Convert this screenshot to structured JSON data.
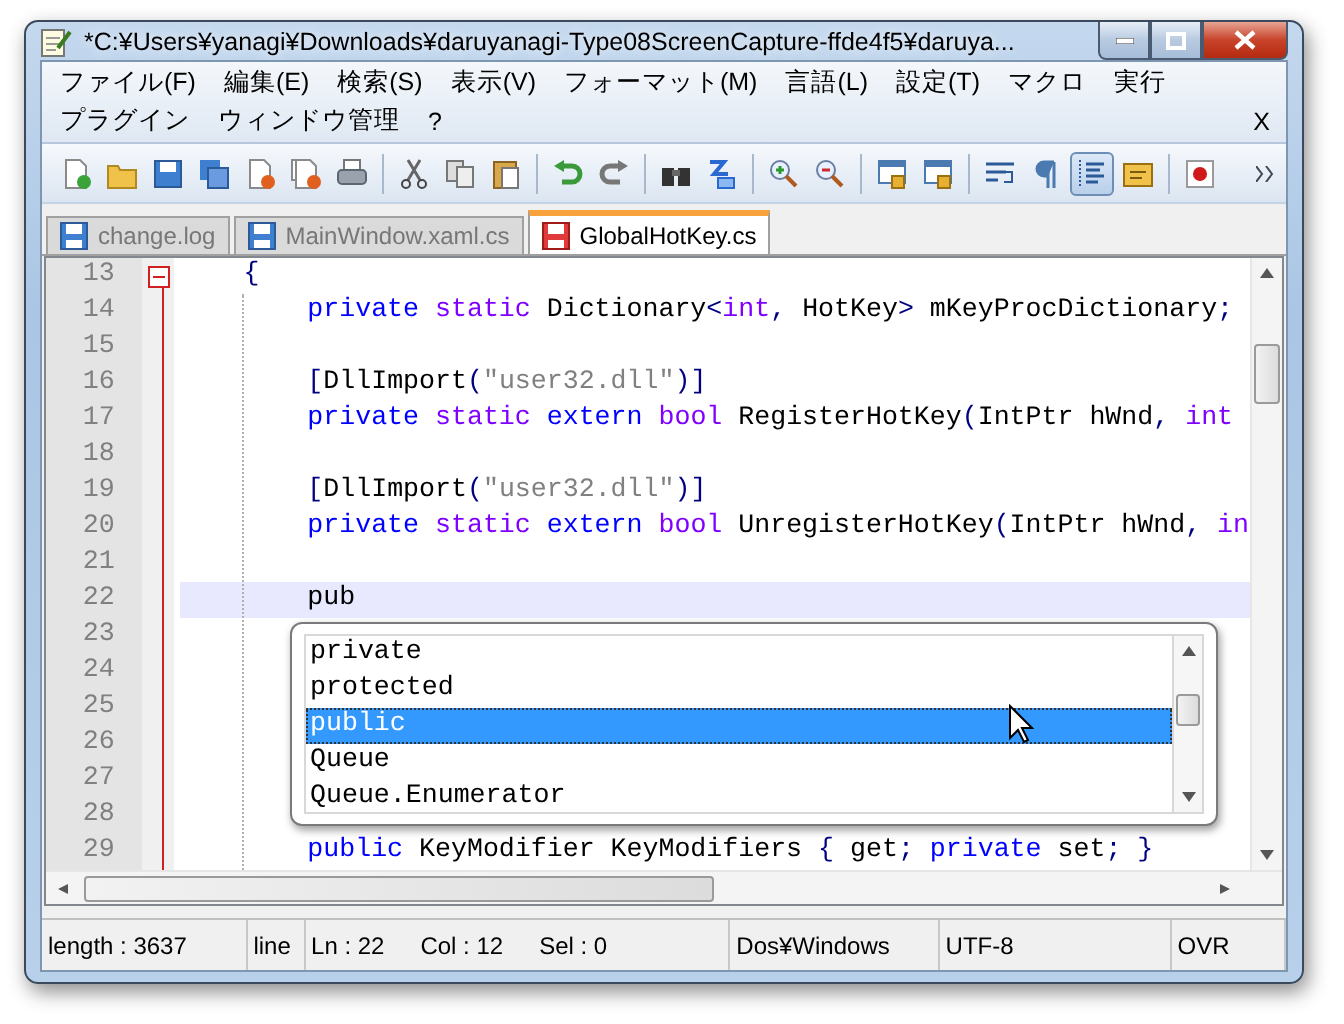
{
  "window": {
    "title": "*C:¥Users¥yanagi¥Downloads¥daruyanagi-Type08ScreenCapture-ffde4f5¥daruya..."
  },
  "menu_rows": [
    {
      "items": [
        "ファイル(F)",
        "編集(E)",
        "検索(S)",
        "表示(V)",
        "フォーマット(M)",
        "言語(L)",
        "設定(T)",
        "マクロ",
        "実行"
      ]
    },
    {
      "items": [
        "プラグイン",
        "ウィンドウ管理",
        "?"
      ]
    }
  ],
  "close_document": "X",
  "toolbar": [
    {
      "kind": "new",
      "pressed": false
    },
    {
      "kind": "open",
      "pressed": false
    },
    {
      "kind": "save",
      "pressed": false
    },
    {
      "kind": "save-all",
      "pressed": false
    },
    {
      "kind": "close",
      "pressed": false
    },
    {
      "kind": "close-all",
      "pressed": false
    },
    {
      "kind": "print",
      "pressed": false
    },
    {
      "kind": "separator"
    },
    {
      "kind": "cut",
      "pressed": false
    },
    {
      "kind": "copy",
      "pressed": false
    },
    {
      "kind": "paste",
      "pressed": false
    },
    {
      "kind": "separator"
    },
    {
      "kind": "undo",
      "pressed": false
    },
    {
      "kind": "redo",
      "pressed": false
    },
    {
      "kind": "separator"
    },
    {
      "kind": "find",
      "pressed": false
    },
    {
      "kind": "replace",
      "pressed": false
    },
    {
      "kind": "separator"
    },
    {
      "kind": "zoom-in",
      "pressed": false
    },
    {
      "kind": "zoom-out",
      "pressed": false
    },
    {
      "kind": "separator"
    },
    {
      "kind": "sync-v",
      "pressed": false
    },
    {
      "kind": "sync-h",
      "pressed": false
    },
    {
      "kind": "separator"
    },
    {
      "kind": "wrap",
      "pressed": false
    },
    {
      "kind": "pilcrow",
      "pressed": false
    },
    {
      "kind": "indent-guide",
      "pressed": true
    },
    {
      "kind": "folder-view",
      "pressed": false
    },
    {
      "kind": "separator"
    },
    {
      "kind": "record",
      "pressed": false
    }
  ],
  "tabs": [
    {
      "label": "change.log",
      "selected": false,
      "modified": false
    },
    {
      "label": "MainWindow.xaml.cs",
      "selected": false,
      "modified": false
    },
    {
      "label": "GlobalHotKey.cs",
      "selected": true,
      "modified": true
    }
  ],
  "editor": {
    "lines": [
      {
        "number": "13",
        "fold_start": true,
        "current": false,
        "tokens": [
          {
            "kind": "op",
            "text": "    {"
          }
        ]
      },
      {
        "number": "14",
        "fold_start": false,
        "current": false,
        "tokens": [
          {
            "kind": "kw",
            "text": "        private"
          },
          {
            "kind": "type",
            "text": " static"
          },
          {
            "kind": "plain",
            "text": " Dictionary"
          },
          {
            "kind": "op",
            "text": "<"
          },
          {
            "kind": "type",
            "text": "int"
          },
          {
            "kind": "op",
            "text": ","
          },
          {
            "kind": "plain",
            "text": " HotKey"
          },
          {
            "kind": "op",
            "text": ">"
          },
          {
            "kind": "plain",
            "text": " mKeyProcDictionary"
          },
          {
            "kind": "op",
            "text": ";"
          }
        ]
      },
      {
        "number": "15",
        "fold_start": false,
        "current": false
      },
      {
        "number": "16",
        "fold_start": false,
        "current": false,
        "tokens": [
          {
            "kind": "op",
            "text": "        ["
          },
          {
            "kind": "plain",
            "text": "DllImport"
          },
          {
            "kind": "op",
            "text": "("
          },
          {
            "kind": "str",
            "text": "\"user32.dll\""
          },
          {
            "kind": "op",
            "text": ")]"
          }
        ]
      },
      {
        "number": "17",
        "fold_start": false,
        "current": false,
        "tokens": [
          {
            "kind": "kw",
            "text": "        private"
          },
          {
            "kind": "type",
            "text": " static"
          },
          {
            "kind": "kw",
            "text": " extern"
          },
          {
            "kind": "type",
            "text": " bool"
          },
          {
            "kind": "plain",
            "text": " RegisterHotKey"
          },
          {
            "kind": "op",
            "text": "("
          },
          {
            "kind": "plain",
            "text": "IntPtr hWnd"
          },
          {
            "kind": "op",
            "text": ","
          },
          {
            "kind": "type",
            "text": " int"
          }
        ]
      },
      {
        "number": "18",
        "fold_start": false,
        "current": false
      },
      {
        "number": "19",
        "fold_start": false,
        "current": false,
        "tokens": [
          {
            "kind": "op",
            "text": "        ["
          },
          {
            "kind": "plain",
            "text": "DllImport"
          },
          {
            "kind": "op",
            "text": "("
          },
          {
            "kind": "str",
            "text": "\"user32.dll\""
          },
          {
            "kind": "op",
            "text": ")]"
          }
        ]
      },
      {
        "number": "20",
        "fold_start": false,
        "current": false,
        "tokens": [
          {
            "kind": "kw",
            "text": "        private"
          },
          {
            "kind": "type",
            "text": " static"
          },
          {
            "kind": "kw",
            "text": " extern"
          },
          {
            "kind": "type",
            "text": " bool"
          },
          {
            "kind": "plain",
            "text": " UnregisterHotKey"
          },
          {
            "kind": "op",
            "text": "("
          },
          {
            "kind": "plain",
            "text": "IntPtr hWnd"
          },
          {
            "kind": "op",
            "text": ","
          },
          {
            "kind": "type",
            "text": " in"
          }
        ]
      },
      {
        "number": "21",
        "fold_start": false,
        "current": false
      },
      {
        "number": "22",
        "fold_start": false,
        "current": true,
        "tokens": [
          {
            "kind": "plain",
            "text": "        pub"
          }
        ]
      },
      {
        "number": "23",
        "fold_start": false,
        "current": false
      },
      {
        "number": "24",
        "fold_start": false,
        "current": false
      },
      {
        "number": "25",
        "fold_start": false,
        "current": false
      },
      {
        "number": "26",
        "fold_start": false,
        "current": false
      },
      {
        "number": "27",
        "fold_start": false,
        "current": false
      },
      {
        "number": "28",
        "fold_start": false,
        "current": false
      },
      {
        "number": "29",
        "fold_start": false,
        "current": false,
        "tokens": [
          {
            "kind": "kw",
            "text": "        public"
          },
          {
            "kind": "plain",
            "text": " KeyModifier KeyModifiers"
          },
          {
            "kind": "op",
            "text": " {"
          },
          {
            "kind": "plain",
            "text": " get"
          },
          {
            "kind": "op",
            "text": ";"
          },
          {
            "kind": "kw",
            "text": " private"
          },
          {
            "kind": "plain",
            "text": " set"
          },
          {
            "kind": "op",
            "text": ";"
          },
          {
            "kind": "op",
            "text": " }"
          }
        ]
      }
    ]
  },
  "autocomplete": {
    "items": [
      {
        "label": "private",
        "selected": false
      },
      {
        "label": "protected",
        "selected": false
      },
      {
        "label": "public",
        "selected": true
      },
      {
        "label": "Queue",
        "selected": false
      },
      {
        "label": "Queue.Enumerator",
        "selected": false
      }
    ]
  },
  "status_bar": {
    "cells": [
      {
        "texts": [
          "length : 3637"
        ]
      },
      {
        "texts": [
          "line"
        ]
      },
      {
        "texts": [
          "Ln : 22",
          "Col : 12",
          "Sel : 0"
        ]
      },
      {
        "texts": [
          "Dos¥Windows"
        ]
      },
      {
        "texts": [
          "UTF-8"
        ]
      },
      {
        "texts": [
          "OVR"
        ]
      }
    ]
  }
}
